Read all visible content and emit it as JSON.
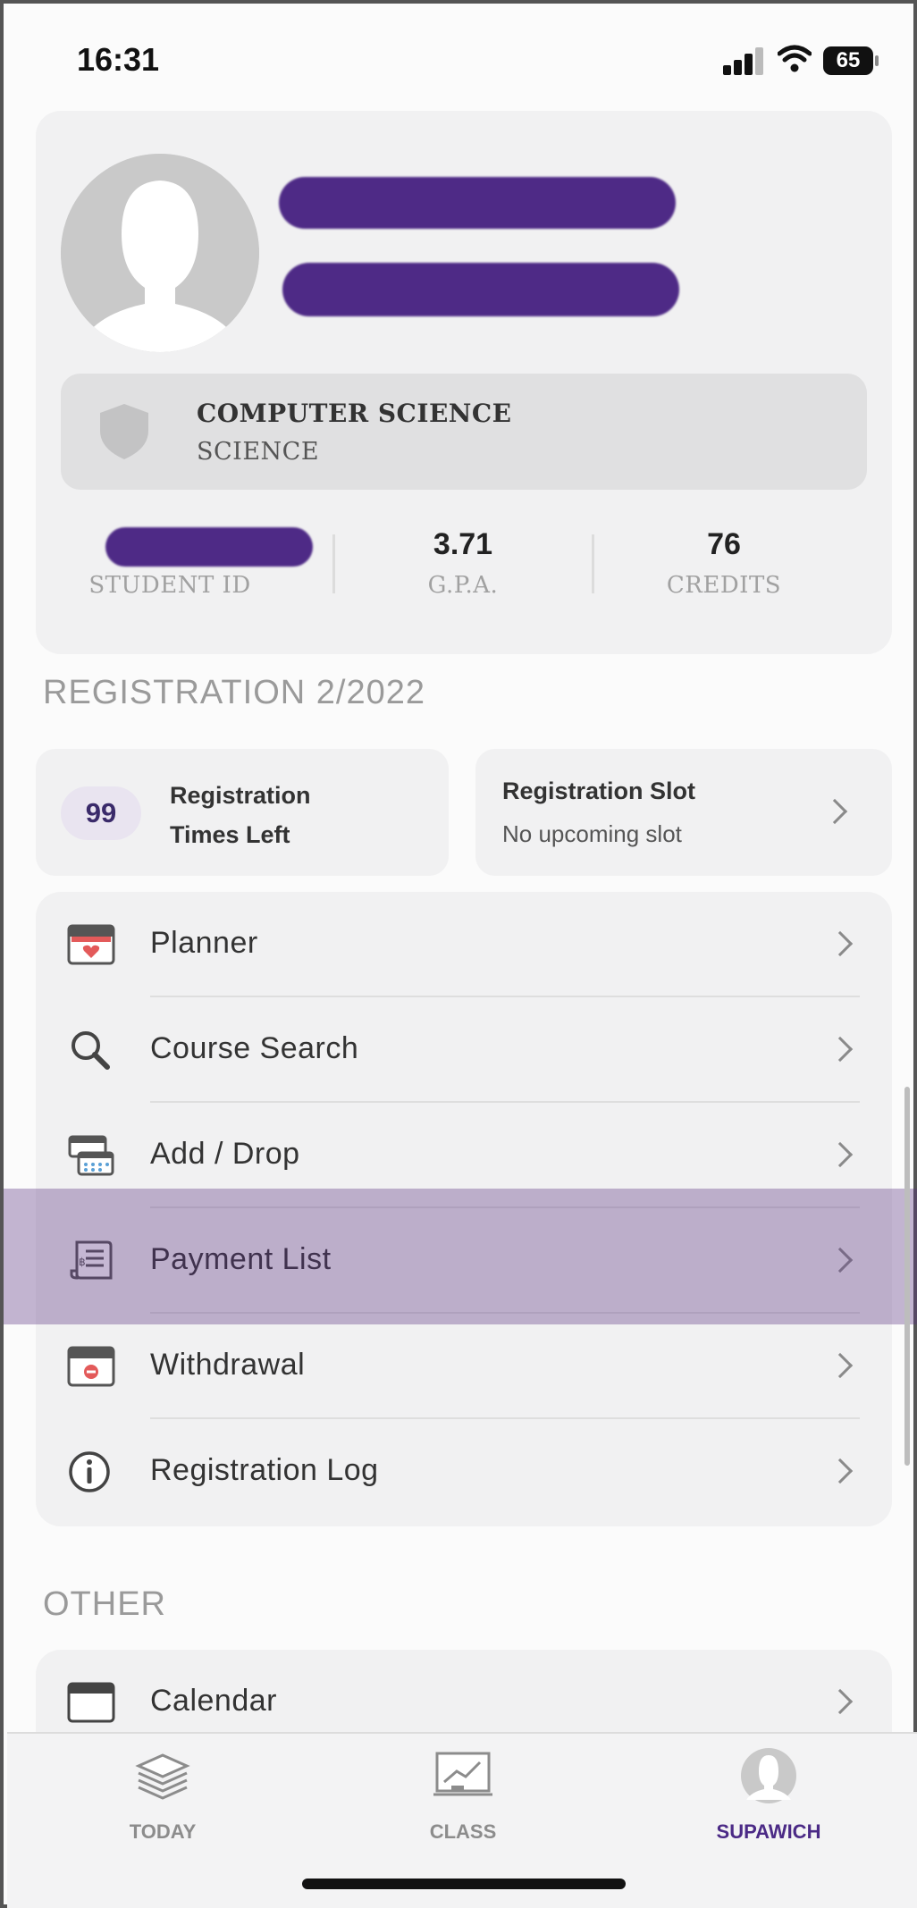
{
  "status_bar": {
    "time": "16:31",
    "battery": "65"
  },
  "profile": {
    "major": "COMPUTER SCIENCE",
    "faculty": "SCIENCE",
    "stats": [
      {
        "value": "",
        "label": "STUDENT ID"
      },
      {
        "value": "3.71",
        "label": "G.P.A."
      },
      {
        "value": "76",
        "label": "CREDITS"
      }
    ]
  },
  "registration": {
    "section_title": "REGISTRATION 2/2022",
    "times_left_count": "99",
    "times_left_label_line1": "Registration",
    "times_left_label_line2": "Times Left",
    "slot_title": "Registration Slot",
    "slot_subtitle": "No upcoming slot"
  },
  "menu": {
    "items": [
      {
        "label": "Planner",
        "icon": "planner-icon"
      },
      {
        "label": "Course Search",
        "icon": "search-icon"
      },
      {
        "label": "Add / Drop",
        "icon": "add-drop-icon"
      },
      {
        "label": "Payment List",
        "icon": "payment-list-icon"
      },
      {
        "label": "Withdrawal",
        "icon": "withdrawal-icon"
      },
      {
        "label": "Registration Log",
        "icon": "info-icon"
      }
    ]
  },
  "other": {
    "section_title": "OTHER",
    "items": [
      {
        "label": "Calendar",
        "icon": "calendar-icon"
      }
    ]
  },
  "tab_bar": {
    "tabs": [
      {
        "label": "TODAY",
        "icon": "stack-icon",
        "active": false
      },
      {
        "label": "CLASS",
        "icon": "chart-board-icon",
        "active": false
      },
      {
        "label": "SUPAWICH",
        "icon": "avatar-icon",
        "active": true
      }
    ]
  },
  "colors": {
    "accent": "#4b2a86",
    "highlight": "#5a3282",
    "card_bg": "#f1f1f2",
    "redaction": "#4e2a86"
  }
}
